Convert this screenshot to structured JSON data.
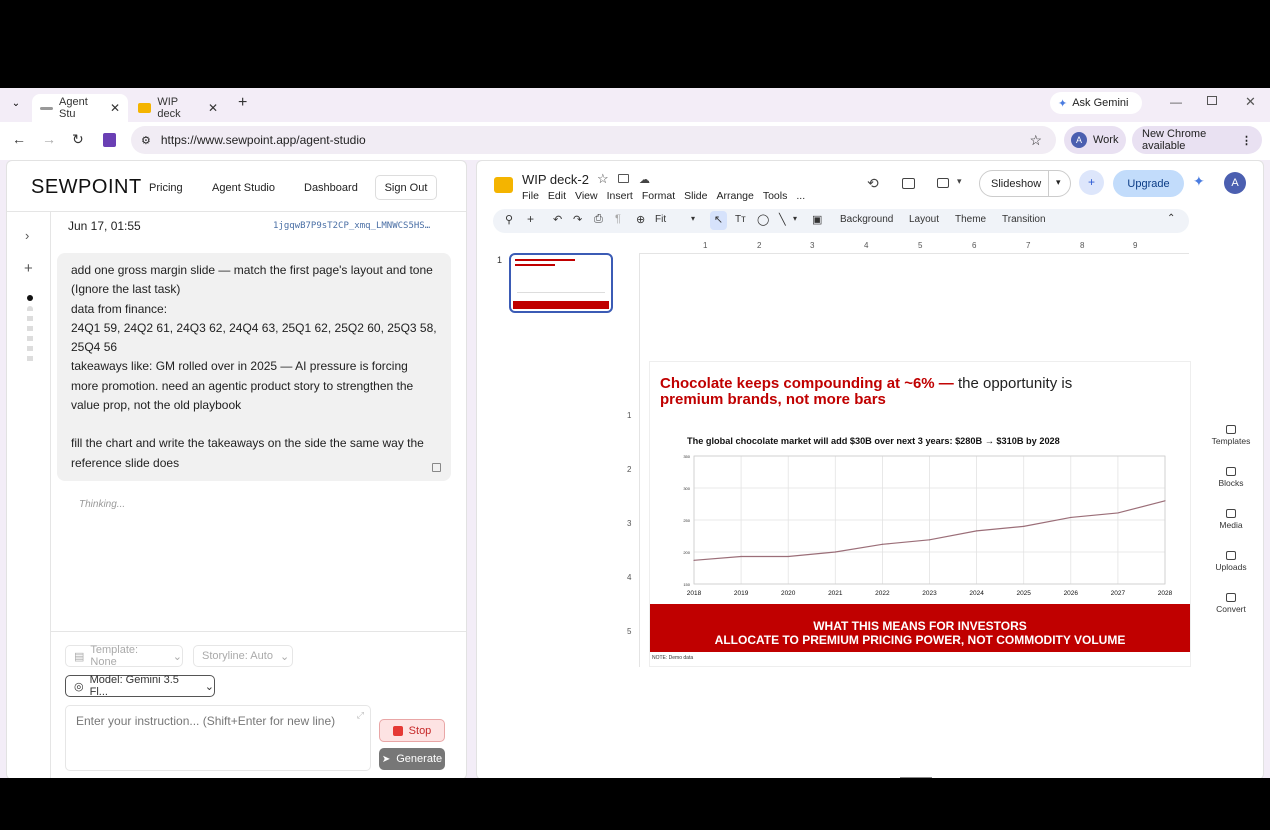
{
  "browser": {
    "tabs": [
      {
        "label": "Agent Stu"
      },
      {
        "label": "WIP deck"
      }
    ],
    "ask_gemini": "Ask Gemini",
    "url": "https://www.sewpoint.app/agent-studio",
    "profile_label": "Work",
    "profile_initial": "A",
    "update_label": "New Chrome available"
  },
  "app": {
    "logo": "SEWPOINT",
    "nav": [
      "Pricing",
      "Agent Studio",
      "Dashboard"
    ],
    "sign_out": "Sign Out",
    "session_date": "Jun 17, 01:55",
    "session_id": "1jgqwB7P9sT2CP_xmq_LMNWCS5HS…",
    "message_lines": [
      "add one gross margin slide — match the first page's layout and tone (Ignore the last task)",
      "data from finance:",
      "24Q1 59, 24Q2 61, 24Q3 62, 24Q4 63, 25Q1 62, 25Q2 60, 25Q3 58, 25Q4 56",
      "takeaways like: GM rolled over in 2025 — AI pressure is forcing more promotion. need an agentic product story to strengthen the value prop, not the old playbook",
      "",
      "fill the chart and write the takeaways on the side the same way the reference slide does"
    ],
    "status": "Thinking...",
    "template_select": "Template: None",
    "storyline_select": "Storyline: Auto",
    "model_select": "Model: Gemini 3.5 Fl...",
    "input_placeholder": "Enter your instruction... (Shift+Enter for new line)",
    "stop_label": "Stop",
    "generate_label": "Generate"
  },
  "deck": {
    "title": "WIP deck-2",
    "menu": [
      "File",
      "Edit",
      "View",
      "Insert",
      "Format",
      "Slide",
      "Arrange",
      "Tools",
      "..."
    ],
    "slideshow": "Slideshow",
    "upgrade": "Upgrade",
    "avatar": "A",
    "zoom": "Fit",
    "toolbar_labels": [
      "Background",
      "Layout",
      "Theme",
      "Transition"
    ],
    "ruler_h": [
      "1",
      "2",
      "3",
      "4",
      "5",
      "6",
      "7",
      "8",
      "9"
    ],
    "ruler_v": [
      "1",
      "2",
      "3",
      "4",
      "5"
    ],
    "slide_number": "1",
    "side_tools": [
      "Templates",
      "Blocks",
      "Media",
      "Uploads",
      "Convert"
    ]
  },
  "slide": {
    "headline_red": "Chocolate keeps compounding at ~6% —",
    "headline_dark": " the opportunity is",
    "headline_red2": "premium brands, not more bars",
    "chart_title": "The global chocolate market will add $30B over next 3 years: $280B → $310B by 2028",
    "banner_line1": "WHAT THIS MEANS FOR INVESTORS",
    "banner_line2": "ALLOCATE TO PREMIUM PRICING POWER, NOT COMMODITY VOLUME",
    "note": "NOTE: Demo data"
  },
  "chart_data": {
    "type": "line",
    "x": [
      "2018",
      "2019",
      "2020",
      "2021",
      "2022",
      "2023",
      "2024",
      "2025",
      "2026",
      "2027",
      "2028"
    ],
    "series": [
      {
        "values": [
          187,
          193,
          193,
          200,
          212,
          219,
          233,
          240,
          254,
          261,
          280
        ]
      }
    ],
    "yticks": [
      "150",
      "200",
      "250",
      "300",
      "350"
    ],
    "ylim": [
      150,
      350
    ],
    "grid": true,
    "line_color": "#9b6e78"
  },
  "colors": {
    "accent_red": "#c00000",
    "upgrade_bg": "#c2dcfb",
    "stop_red": "#e53935"
  }
}
